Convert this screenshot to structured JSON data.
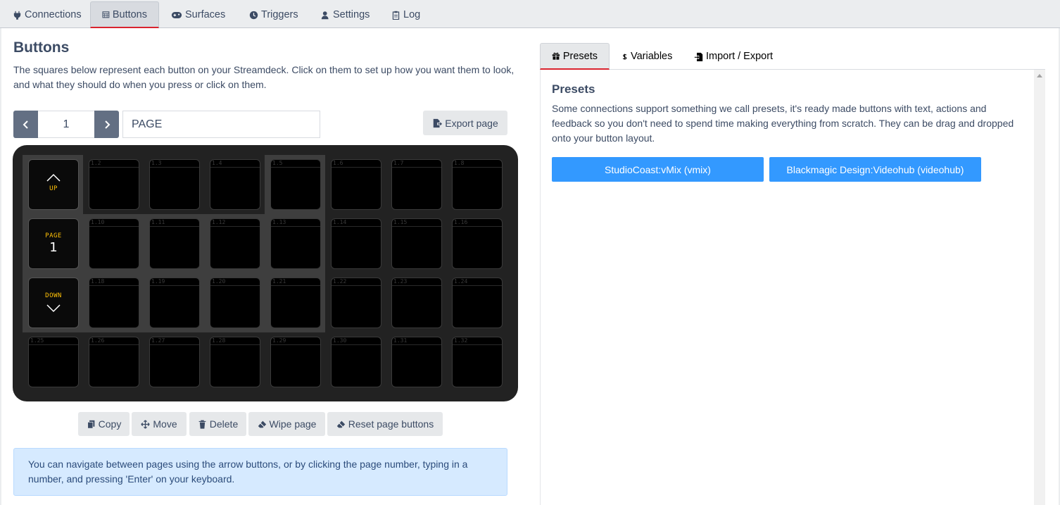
{
  "top_tabs": [
    {
      "label": "Connections",
      "icon": "plug-icon"
    },
    {
      "label": "Buttons",
      "icon": "calendar-grid-icon"
    },
    {
      "label": "Surfaces",
      "icon": "gamepad-icon"
    },
    {
      "label": "Triggers",
      "icon": "clock-icon"
    },
    {
      "label": "Settings",
      "icon": "user-gear-icon"
    },
    {
      "label": "Log",
      "icon": "clipboard-icon"
    }
  ],
  "active_tab": "Buttons",
  "buttons_page": {
    "title": "Buttons",
    "description": "The squares below represent each button on your Streamdeck. Click on them to set up how you want them to look, and what they should do when you press or click on them.",
    "page_number": "1",
    "page_name": "PAGE",
    "export_label": "Export page",
    "nav_keys": {
      "up": "UP",
      "page": "PAGE",
      "page_number": "1",
      "down": "DOWN"
    },
    "key_labels": [
      "1.2",
      "1.3",
      "1.4",
      "1.5",
      "1.6",
      "1.7",
      "1.8",
      "1.10",
      "1.11",
      "1.12",
      "1.13",
      "1.14",
      "1.15",
      "1.16",
      "1.18",
      "1.19",
      "1.20",
      "1.21",
      "1.22",
      "1.23",
      "1.24",
      "1.25",
      "1.26",
      "1.27",
      "1.28",
      "1.29",
      "1.30",
      "1.31",
      "1.32"
    ],
    "actions": {
      "copy": "Copy",
      "move": "Move",
      "delete": "Delete",
      "wipe": "Wipe page",
      "reset": "Reset page buttons"
    },
    "info": "You can navigate between pages using the arrow buttons, or by clicking the page number, typing in a number, and pressing 'Enter' on your keyboard."
  },
  "right_tabs": [
    {
      "label": "Presets",
      "icon": "gift-icon"
    },
    {
      "label": "Variables",
      "icon": "dollar-icon"
    },
    {
      "label": "Import / Export",
      "icon": "file-import-icon"
    }
  ],
  "presets": {
    "title": "Presets",
    "description": "Some connections support something we call presets, it's ready made buttons with text, actions and feedback so you don't need to spend time making everything from scratch. They can be drag and dropped onto your button layout.",
    "items": [
      "StudioCoast:vMix (vmix)",
      "Blackmagic Design:Videohub (videohub)"
    ]
  },
  "colors": {
    "accent": "#3399ff",
    "active_underline": "#d9232e",
    "nav_text": "#ffc107"
  }
}
